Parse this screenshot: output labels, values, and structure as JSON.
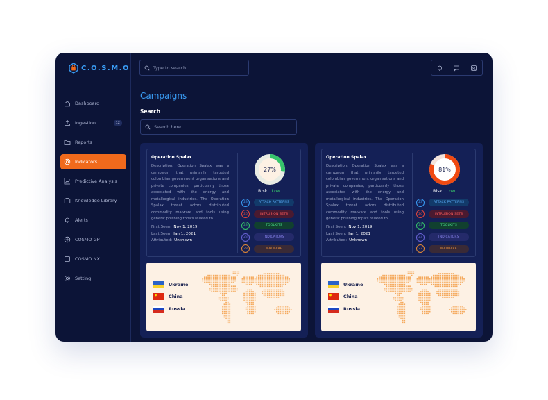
{
  "brand": {
    "name": "C.O.S.M.O"
  },
  "header": {
    "search_placeholder": "Type to search..."
  },
  "sidebar": {
    "items": [
      {
        "label": "Dashboard",
        "icon": "home-icon"
      },
      {
        "label": "Ingestion",
        "icon": "upload-icon",
        "badge": "12"
      },
      {
        "label": "Reports",
        "icon": "folder-icon"
      },
      {
        "label": "Indicators",
        "icon": "target-icon",
        "active": true
      },
      {
        "label": "Predictive Analysis",
        "icon": "chart-line-icon"
      },
      {
        "label": "Knowledge Library",
        "icon": "library-icon"
      },
      {
        "label": "Alerts",
        "icon": "bell-icon"
      },
      {
        "label": "COSMO GPT",
        "icon": "sparkle-icon"
      },
      {
        "label": "COSMO NX",
        "icon": "box-icon"
      },
      {
        "label": "Setting",
        "icon": "gear-icon"
      }
    ]
  },
  "page": {
    "title": "Campaigns",
    "search_label": "Search",
    "search_placeholder": "Search here..."
  },
  "campaigns": [
    {
      "title": "Operation Spalax",
      "description": "Description: Operation Spalax was a campaign that primarily targeted colombian government organisations and private companies, particularly those associated with the energy and metallurgical industries. The Operation Spalax threat actors distributed commodity malware and tools using generic phishing topics related to...",
      "first_seen_label": "First Seen:",
      "first_seen": "Nov 1, 2019",
      "last_seen_label": "Last Seen:",
      "last_seen": "Jan 1, 2021",
      "attributed_label": "Attributed:",
      "attributed": "Unknown",
      "percent": 27,
      "percent_label": "27%",
      "ring_color": "#36c56b",
      "ring_inner": "#fdf1e4",
      "risk_label": "Risk:",
      "risk": "Low",
      "tags": [
        {
          "count": "23",
          "label": "ATTACK PATTERNS",
          "color": "blue"
        },
        {
          "count": "26",
          "label": "INTRUSION SETS",
          "color": "red"
        },
        {
          "count": "23",
          "label": "TOOLKITS",
          "color": "green"
        },
        {
          "count": "23",
          "label": "INDICATORS",
          "color": "purple"
        },
        {
          "count": "23",
          "label": "MALWARE",
          "color": "orange"
        }
      ],
      "countries": [
        "Ukraine",
        "China",
        "Russia"
      ]
    },
    {
      "title": "Operation Spalax",
      "description": "Description: Operation Spalax was a campaign that primarily targeted colombian government organisations and private companies, particularly those associated with the energy and metallurgical industries. The Operation Spalax threat actors distributed commodity malware and tools using generic phishing topics related to...",
      "first_seen_label": "First Seen:",
      "first_seen": "Nov 1, 2019",
      "last_seen_label": "Last Seen:",
      "last_seen": "Jan 1, 2021",
      "attributed_label": "Attributed:",
      "attributed": "Unknown",
      "percent": 81,
      "percent_label": "81%",
      "ring_color": "#f04a12",
      "ring_inner": "#ffffff",
      "risk_label": "Risk:",
      "risk": "Low",
      "tags": [
        {
          "count": "23",
          "label": "ATTACK PATTERNS",
          "color": "blue"
        },
        {
          "count": "26",
          "label": "INTRUSION SETS",
          "color": "red"
        },
        {
          "count": "23",
          "label": "TOOLKITS",
          "color": "green"
        },
        {
          "count": "23",
          "label": "INDICATORS",
          "color": "purple"
        },
        {
          "count": "23",
          "label": "MALWARE",
          "color": "orange"
        }
      ],
      "countries": [
        "Ukraine",
        "China",
        "Russia"
      ]
    }
  ]
}
